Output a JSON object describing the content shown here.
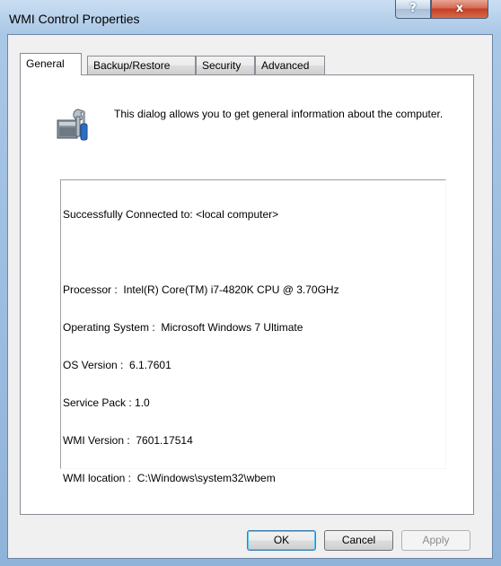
{
  "window": {
    "title": "WMI Control Properties",
    "help_glyph": "?",
    "close_glyph": "x"
  },
  "tabs": [
    {
      "label": "General",
      "active": true
    },
    {
      "label": "Backup/Restore",
      "active": false
    },
    {
      "label": "Security",
      "active": false
    },
    {
      "label": "Advanced",
      "active": false
    }
  ],
  "general": {
    "icon": "wmi-computer-tools-icon",
    "description": "This dialog allows you to get general information about the computer.",
    "status": "Successfully Connected to: <local computer>",
    "info_lines": [
      "Processor :  Intel(R) Core(TM) i7-4820K CPU @ 3.70GHz",
      "Operating System :  Microsoft Windows 7 Ultimate",
      "OS Version :  6.1.7601",
      "Service Pack : 1.0",
      "WMI Version :  7601.17514",
      "WMI location :  C:\\Windows\\system32\\wbem"
    ]
  },
  "buttons": {
    "ok": "OK",
    "cancel": "Cancel",
    "apply": "Apply"
  },
  "colors": {
    "frame": "#8fb3d9",
    "close_button": "#c43f24",
    "default_button_glow": "#4ec7f7"
  }
}
